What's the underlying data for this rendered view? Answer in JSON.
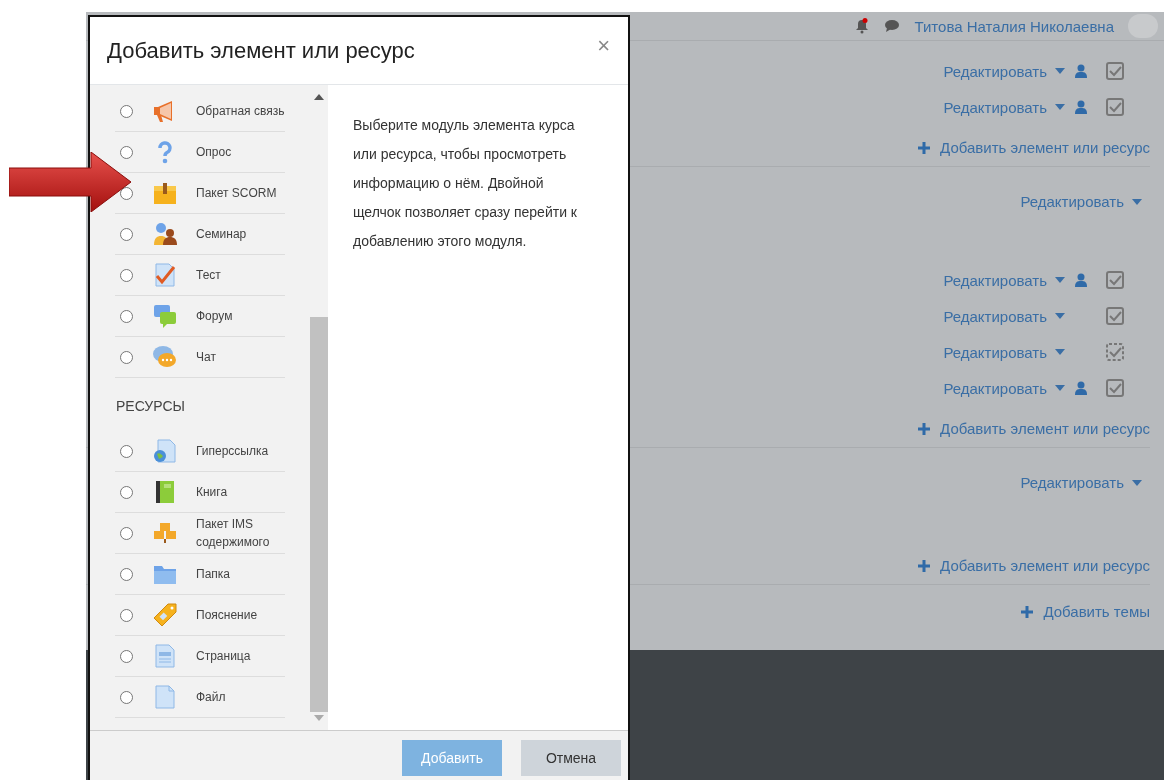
{
  "header": {
    "user_name": "Титова Наталия Николаевна"
  },
  "sections": [
    {
      "activities": [
        {
          "edit": "Редактировать",
          "group_icon": true,
          "auto_completion": false
        },
        {
          "edit": "Редактировать",
          "group_icon": true,
          "auto_completion": false
        }
      ],
      "add_link": "Добавить элемент или ресурс"
    },
    {
      "edit": "Редактировать",
      "activities": [
        {
          "edit": "Редактировать",
          "group_icon": true,
          "auto_completion": false
        },
        {
          "edit": "Редактировать",
          "group_icon": false,
          "auto_completion": false
        },
        {
          "edit": "Редактировать",
          "group_icon": false,
          "auto_completion": true
        },
        {
          "edit": "Редактировать",
          "group_icon": true,
          "auto_completion": false
        }
      ],
      "add_link": "Добавить элемент или ресурс"
    },
    {
      "edit": "Редактировать",
      "add_link": "Добавить элемент или ресурс"
    }
  ],
  "add_topics": "Добавить темы",
  "dialog": {
    "title": "Добавить элемент или ресурс",
    "close": "×",
    "groups": [
      {
        "items": [
          {
            "label": "Обратная связь",
            "kind": "feedback",
            "selected": false
          },
          {
            "label": "Опрос",
            "kind": "survey",
            "selected": false
          },
          {
            "label": "Пакет SCORM",
            "kind": "scorm",
            "selected": false
          },
          {
            "label": "Семинар",
            "kind": "workshop",
            "selected": false
          },
          {
            "label": "Тест",
            "kind": "quiz",
            "selected": false
          },
          {
            "label": "Форум",
            "kind": "forum",
            "selected": false
          },
          {
            "label": "Чат",
            "kind": "chat",
            "selected": false
          }
        ]
      },
      {
        "heading": "РЕСУРСЫ",
        "items": [
          {
            "label": "Гиперссылка",
            "kind": "url",
            "selected": false
          },
          {
            "label": "Книга",
            "kind": "book",
            "selected": false
          },
          {
            "label": "Пакет IMS содержимого",
            "kind": "ims",
            "selected": false
          },
          {
            "label": "Папка",
            "kind": "folder",
            "selected": false
          },
          {
            "label": "Пояснение",
            "kind": "label",
            "selected": false
          },
          {
            "label": "Страница",
            "kind": "page",
            "selected": false
          },
          {
            "label": "Файл",
            "kind": "file",
            "selected": false
          }
        ]
      }
    ],
    "description": "Выберите модуль элемента курса или ресурса, чтобы просмотреть информацию о нём. Двойной щелчок позволяет сразу перейти к добавлению этого модуля.",
    "buttons": [
      {
        "label": "Добавить",
        "kind": "primary"
      },
      {
        "label": "Отмена",
        "kind": "secondary"
      }
    ]
  }
}
